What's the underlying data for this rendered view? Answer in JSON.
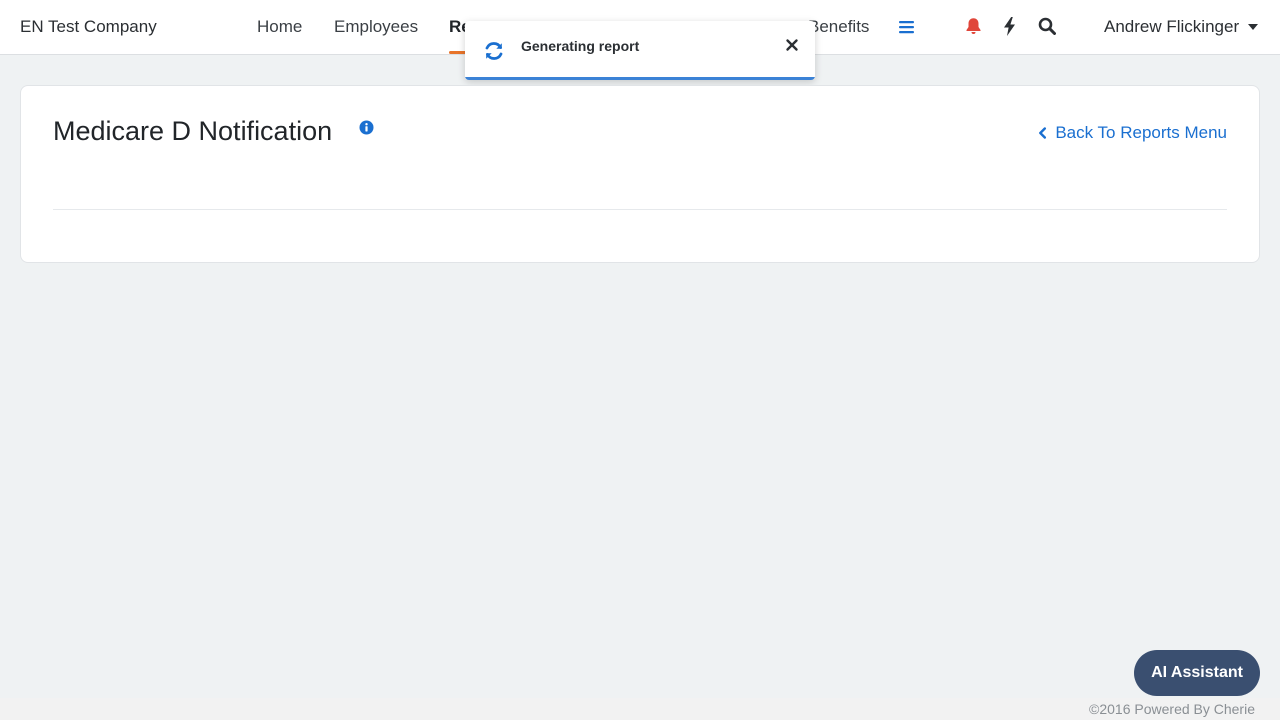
{
  "header": {
    "company": "EN Test Company",
    "nav": [
      {
        "label": "Home"
      },
      {
        "label": "Employees"
      },
      {
        "label": "Re"
      },
      {
        "label": "Benefits"
      }
    ],
    "user_name": "Andrew Flickinger",
    "icons": [
      "menu-icon",
      "bell-icon",
      "bolt-icon",
      "search-icon"
    ],
    "colors": {
      "active_underline": "#e8742a",
      "bell": "#e0463a",
      "menu": "#1a6fd0"
    }
  },
  "toast": {
    "message": "Generating report",
    "icon": "refresh-icon",
    "progress_color": "#3b82d6"
  },
  "page": {
    "title": "Medicare D Notification",
    "back_link": "Back To Reports Menu",
    "link_color": "#1a6fd0"
  },
  "assistant": {
    "label": "AI Assistant",
    "color": "#3a4f70"
  },
  "footer": {
    "text": "©2016 Powered By Cherie"
  }
}
